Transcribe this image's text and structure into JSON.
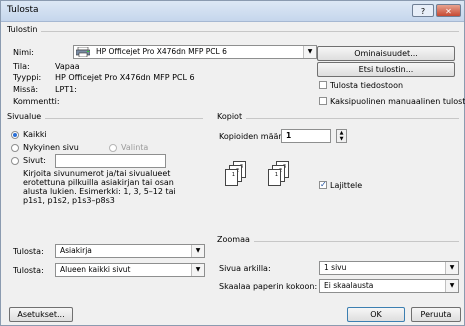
{
  "title": "Tulosta",
  "titlebar": {
    "help_glyph": "?",
    "close_glyph": "✕"
  },
  "printer": {
    "group_label": "Tulostin",
    "name_label": "Nimi:",
    "name_value": "HP Officejet Pro X476dn MFP PCL 6",
    "status_label": "Tila:",
    "status_value": "Vapaa",
    "type_label": "Tyyppi:",
    "type_value": "HP Officejet Pro X476dn MFP PCL 6",
    "where_label": "Missä:",
    "where_value": "LPT1:",
    "comment_label": "Kommentti:",
    "comment_value": "",
    "properties_button": "Ominaisuudet...",
    "find_button": "Etsi tulostin...",
    "print_to_file": "Tulosta tiedostoon",
    "manual_duplex": "Kaksipuolinen manuaalinen tulostus"
  },
  "page_range": {
    "group_label": "Sivualue",
    "all": "Kaikki",
    "current": "Nykyinen sivu",
    "selection": "Valinta",
    "pages": "Sivut:",
    "pages_value": "",
    "help_text_1": "Kirjoita sivunumerot ja/tai sivualueet",
    "help_text_2": "erotettuna pilkuilla asiakirjan tai osan",
    "help_text_3": "alusta lukien. Esimerkki: 1, 3, 5–12 tai",
    "help_text_4": "p1s1, p1s2, p1s3–p8s3"
  },
  "copies": {
    "group_label": "Kopiot",
    "count_label": "Kopioiden määrä:",
    "count_value": "1",
    "collate": "Lajittele",
    "collate_checked": true
  },
  "print_what": {
    "label": "Tulosta:",
    "value": "Asiakirja"
  },
  "print": {
    "label": "Tulosta:",
    "value": "Alueen kaikki sivut"
  },
  "zoom": {
    "group_label": "Zoomaa",
    "pages_per_sheet_label": "Sivua arkilla:",
    "pages_per_sheet_value": "1 sivu",
    "scale_label": "Skaalaa paperin kokoon:",
    "scale_value": "Ei skaalausta"
  },
  "buttons": {
    "options": "Asetukset...",
    "ok": "OK",
    "cancel": "Peruuta"
  },
  "pages_sequence": [
    "1",
    "2",
    "3",
    "1",
    "2",
    "3"
  ]
}
